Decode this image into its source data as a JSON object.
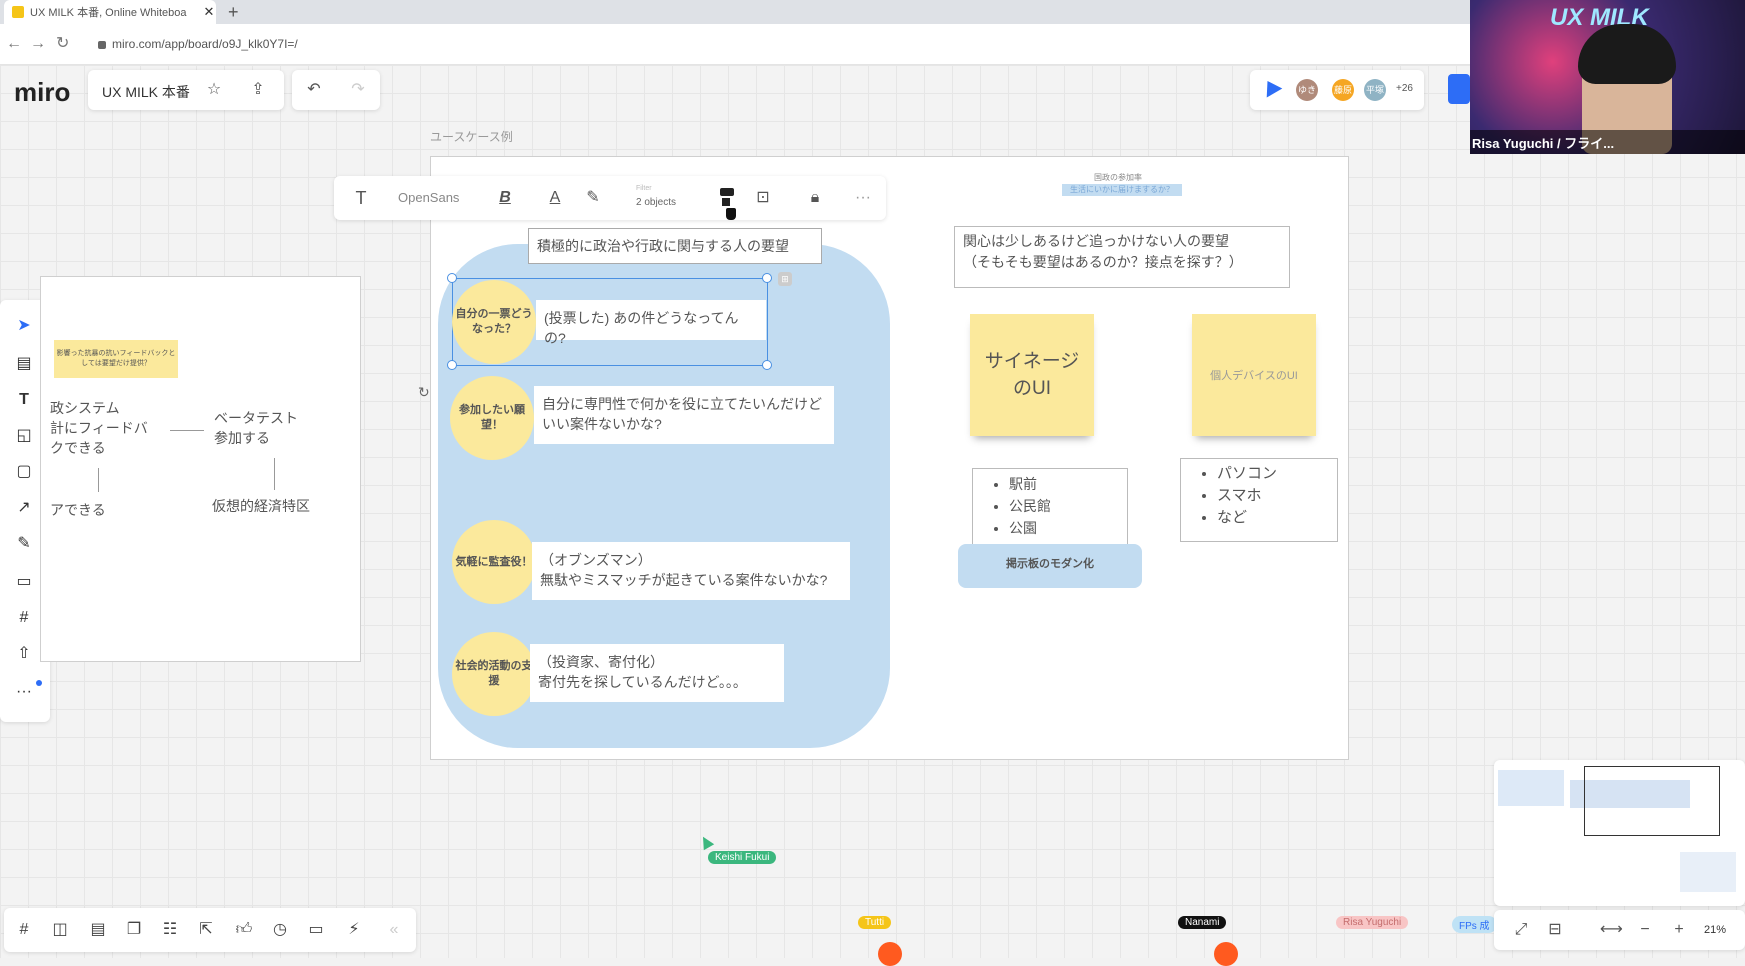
{
  "browser": {
    "tab_title": "UX MILK 本番, Online Whiteboa",
    "tab_close": "✕",
    "new_tab": "+",
    "url": "miro.com/app/board/o9J_klk0Y7I=/"
  },
  "app": {
    "logo": "miro",
    "board_name": "UX MILK 本番",
    "star_icon": "☆",
    "share_icon": "⇪",
    "undo_icon": "↶",
    "redo_icon": "↷"
  },
  "header_right": {
    "collaborators_count": "+26",
    "avatars": [
      "ゆき",
      "藤原",
      "平塚"
    ]
  },
  "video": {
    "banner": "UX MILK",
    "name": "Risa Yuguchi / フライ..."
  },
  "frame_label": "ユースケース例",
  "format_toolbar": {
    "text_tool": "T",
    "font": "OpenSans",
    "bold": "B",
    "color": "A",
    "filter_label": "Filter",
    "filter_value": "2 objects",
    "more": "···"
  },
  "main_board": {
    "group_title": "積極的に政治や行政に関与する人の要望",
    "rows": [
      {
        "circle": "自分の一票どうなった？",
        "text": "(投票した) あの件どうなってんの?"
      },
      {
        "circle": "参加したい願望！",
        "text": "自分に専門性で何かを役に立てたいんだけどいい案件ないかな?"
      },
      {
        "circle": "気軽に監査役！",
        "text": "（オブンズマン）\n無駄やミスマッチが起きている案件ないかな?"
      },
      {
        "circle": "社会的活動の支援",
        "text": "（投資家、寄付化）\n寄付先を探しているんだけど。。。"
      }
    ],
    "right_group_title": "関心は少しあるけど追っかけない人の要望\n（そもそも要望はあるのか？接点を探す？）",
    "tiny_label_1": "国政の参加率",
    "tiny_label_2": "生活にいかに届けまするか？",
    "note_signage": "サイネージ\nのUI",
    "note_device": "個人デバイスのUI",
    "list_signage": [
      "駅前",
      "公民館",
      "公園"
    ],
    "list_device": [
      "パソコン",
      "スマホ",
      "など"
    ],
    "blue_label": "掲示板のモダン化"
  },
  "left_frame": {
    "note": "影響った抗暴の抗いフィードバックとしては要望だけ提供？",
    "item1": "政システム\n計にフィードバ\nクできる",
    "item2": "ベータテスト\n参加する",
    "item3": "アできる",
    "item4": "仮想的経済特区"
  },
  "cursors": {
    "keishi": "Keishi Fukui",
    "tutti": "Tutti",
    "nanami": "Nanami",
    "risa": "Risa Yuguchi",
    "fps": "FPs 成"
  },
  "bottom_bar": {
    "collapse": "«",
    "zoom": "21%"
  },
  "colors": {
    "note_yellow": "#fbe99c",
    "group_blue": "#c2dcf1",
    "selection": "#4a90e2"
  }
}
